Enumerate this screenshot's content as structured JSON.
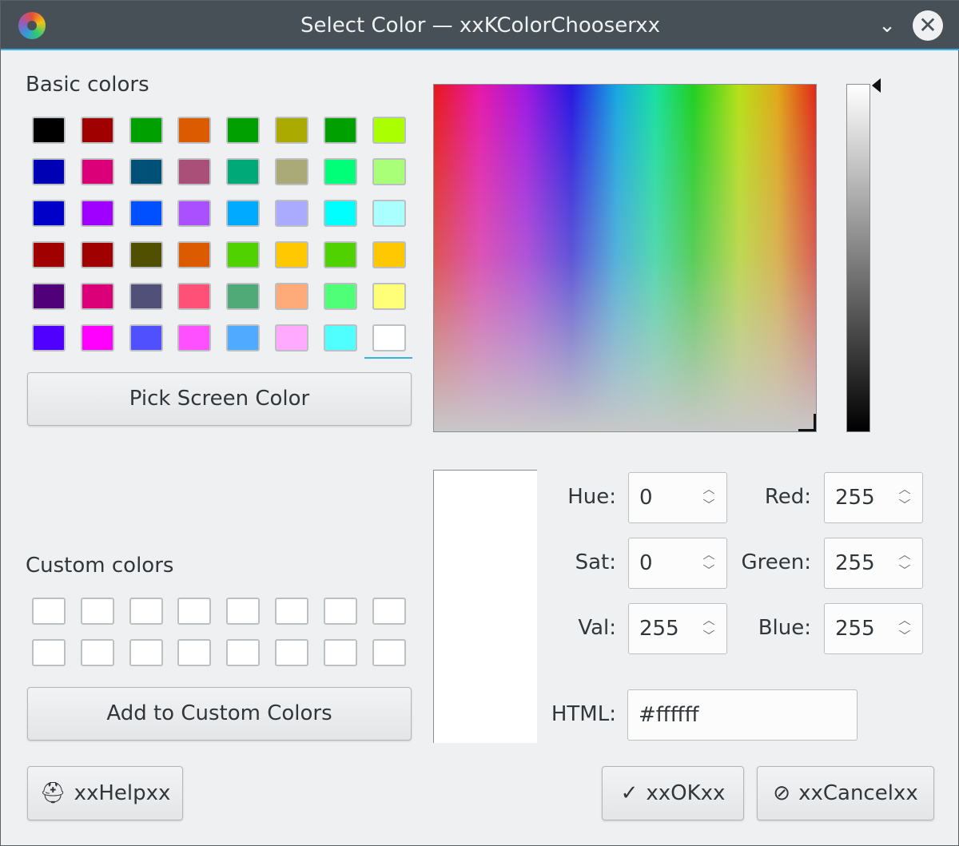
{
  "window": {
    "title": "Select Color — xxKColorChooserxx",
    "minimize_glyph": "⌄",
    "close_glyph": "✕"
  },
  "basic_colors": {
    "label": "Basic colors",
    "swatches": [
      "#000000",
      "#a00000",
      "#00a000",
      "#dc5a00",
      "#00a000",
      "#aaaa00",
      "#00a000",
      "#aaff00",
      "#0000b4",
      "#dc0078",
      "#005078",
      "#aa5078",
      "#00aa78",
      "#aaaa78",
      "#00ff78",
      "#aaff78",
      "#0000c8",
      "#a000ff",
      "#0050ff",
      "#aa50ff",
      "#00aaff",
      "#aaaaff",
      "#00ffff",
      "#aaffff",
      "#a00000",
      "#a00000",
      "#505000",
      "#dc5a00",
      "#50d200",
      "#ffc800",
      "#50d200",
      "#ffc800",
      "#500078",
      "#dc0078",
      "#505078",
      "#ff5078",
      "#50aa78",
      "#ffaa78",
      "#50ff78",
      "#ffff78",
      "#5000ff",
      "#ff00ff",
      "#5050ff",
      "#ff50ff",
      "#50aaff",
      "#ffaaff",
      "#50ffff",
      "#ffffff"
    ]
  },
  "pick_screen_color_label": "Pick Screen Color",
  "custom_colors": {
    "label": "Custom colors",
    "count": 16
  },
  "add_custom_label": "Add to Custom Colors",
  "fields": {
    "hue": {
      "label": "Hue:",
      "value": "0"
    },
    "sat": {
      "label": "Sat:",
      "value": "0"
    },
    "val": {
      "label": "Val:",
      "value": "255"
    },
    "red": {
      "label": "Red:",
      "value": "255"
    },
    "green": {
      "label": "Green:",
      "value": "255"
    },
    "blue": {
      "label": "Blue:",
      "value": "255"
    },
    "html": {
      "label": "HTML:",
      "value": "#ffffff"
    }
  },
  "buttons": {
    "help": {
      "label": "xxHelpxx",
      "icon": "help-lifebuoy-icon"
    },
    "ok": {
      "label": "xxOKxx",
      "icon": "checkmark-icon"
    },
    "cancel": {
      "label": "xxCancelxx",
      "icon": "cancel-circle-icon"
    }
  },
  "colors": {
    "titlebar": "#475057",
    "accent": "#3daee9",
    "selected_color": "#ffffff"
  }
}
